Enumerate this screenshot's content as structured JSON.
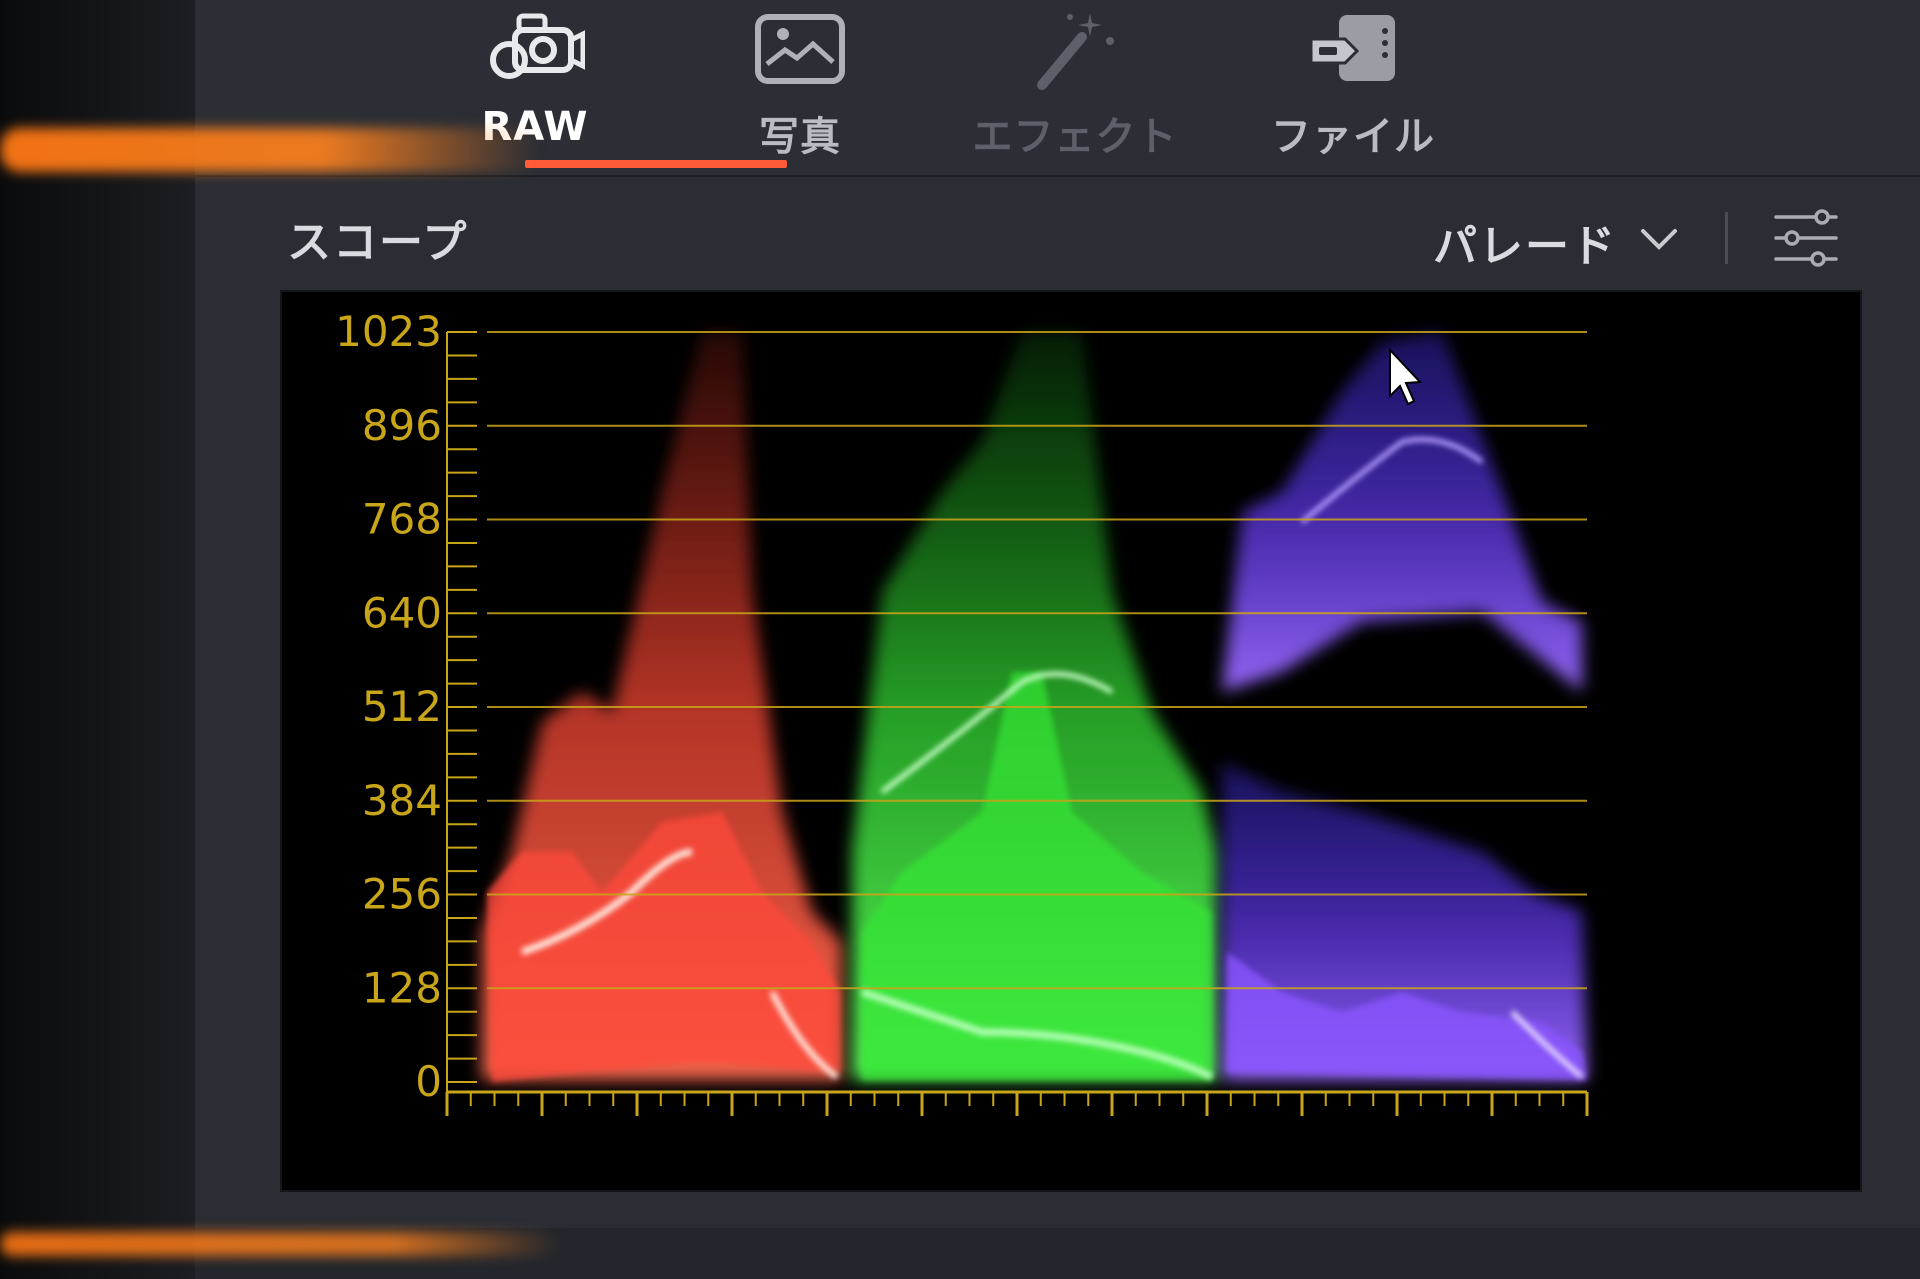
{
  "tabs": [
    {
      "id": "raw",
      "label": "RAW",
      "icon": "camera-icon",
      "state": "active"
    },
    {
      "id": "photo",
      "label": "写真",
      "icon": "image-icon",
      "state": "normal"
    },
    {
      "id": "effect",
      "label": "エフェクト",
      "icon": "magic-wand-icon",
      "state": "disabled"
    },
    {
      "id": "file",
      "label": "ファイル",
      "icon": "file-tag-icon",
      "state": "normal"
    }
  ],
  "panel": {
    "title": "スコープ",
    "mode_label": "パレード",
    "mode_icon": "chevron-down-icon",
    "settings_icon": "sliders-icon"
  },
  "scope": {
    "type": "RGB parade",
    "y_ticks": [
      "1023",
      "896",
      "768",
      "640",
      "512",
      "384",
      "256",
      "128",
      "0"
    ],
    "y_range": [
      0,
      1023
    ],
    "channels": [
      "red",
      "green",
      "blue"
    ]
  },
  "colors": {
    "accent": "#ff5a36",
    "graticule": "#c9a51a",
    "red_trace": "#ff4a3a",
    "green_trace": "#3cff3c",
    "blue_trace": "#7a4dff"
  }
}
